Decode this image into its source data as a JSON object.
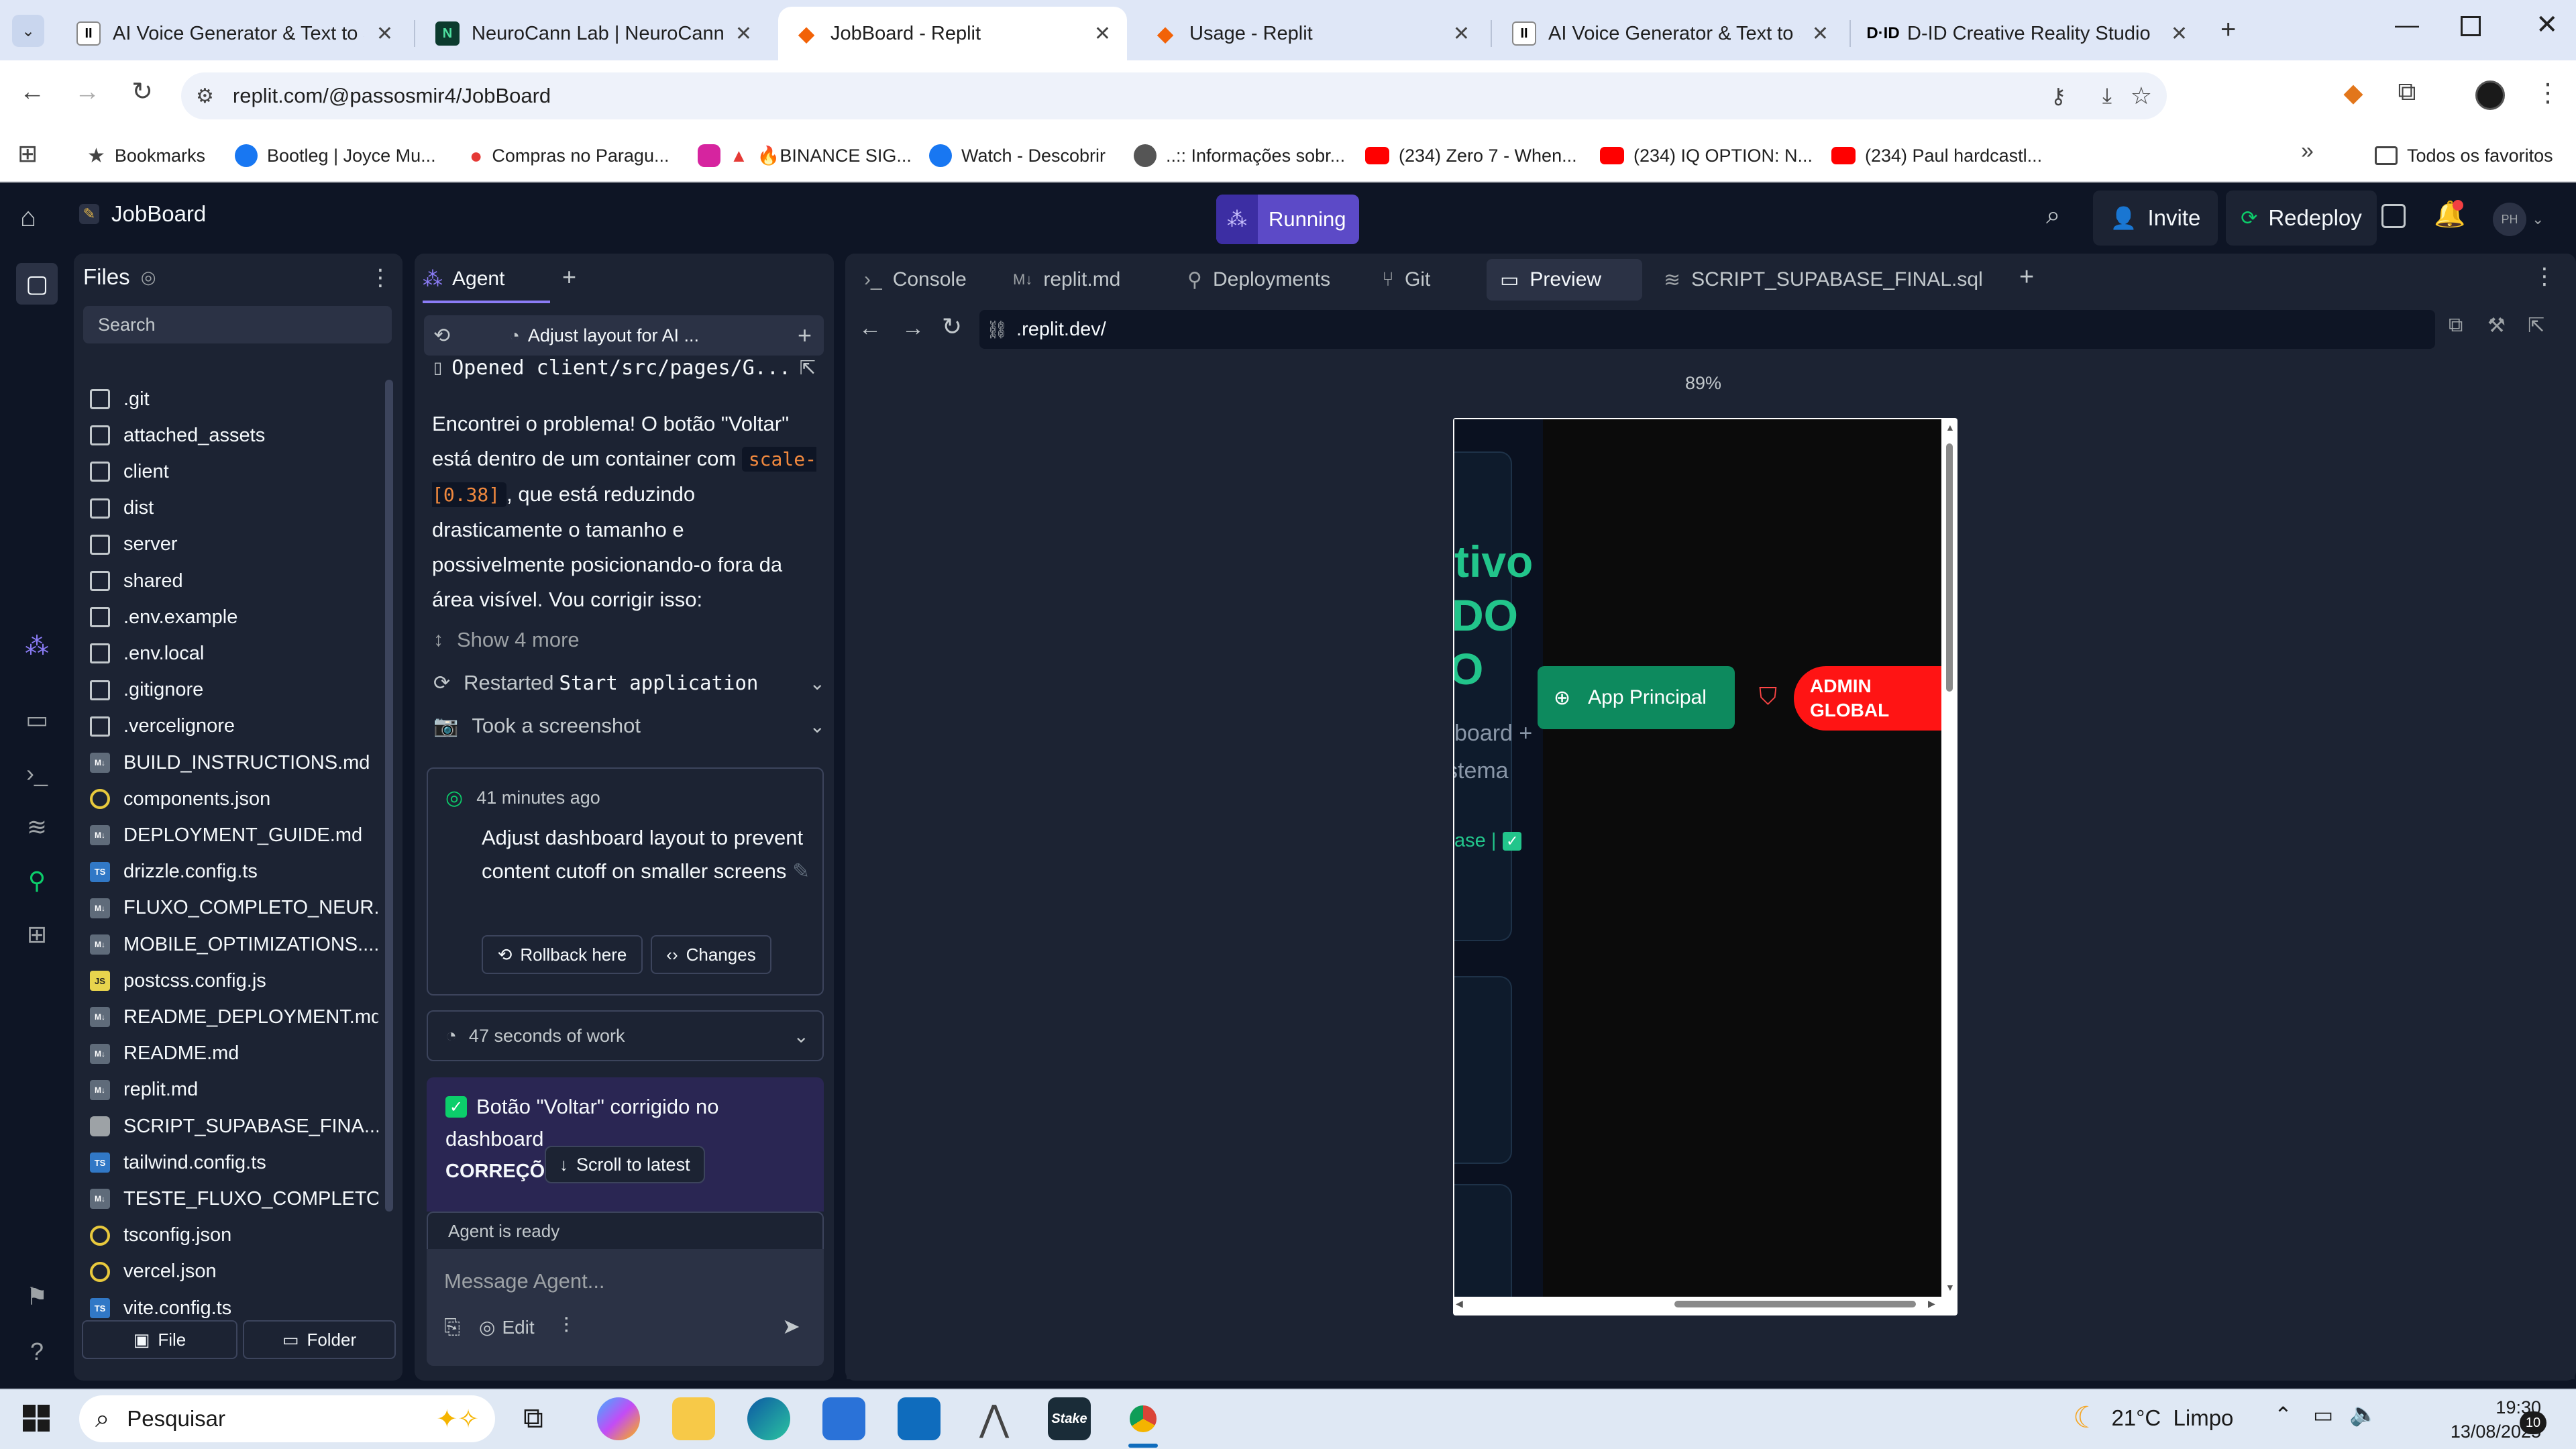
{
  "browser": {
    "tabs": [
      {
        "title": "AI Voice Generator & Text to Sp",
        "active": false,
        "favicon": "elevenlabs-icon"
      },
      {
        "title": "NeuroCann Lab | NeuroCann La",
        "active": false,
        "favicon": "neurocann-icon"
      },
      {
        "title": "JobBoard - Replit",
        "active": true,
        "favicon": "replit-icon"
      },
      {
        "title": "Usage - Replit",
        "active": false,
        "favicon": "replit-icon"
      },
      {
        "title": "AI Voice Generator & Text to Sp",
        "active": false,
        "favicon": "elevenlabs-icon"
      },
      {
        "title": "D-ID Creative Reality Studio",
        "active": false,
        "favicon": "d-id-icon"
      }
    ],
    "url": "replit.com/@passosmir4/JobBoard",
    "bookmarks": [
      {
        "label": "Bookmarks"
      },
      {
        "label": "Bootleg | Joyce Mu..."
      },
      {
        "label": "Compras no Paragu..."
      },
      {
        "label": "🔥BINANCE SIG..."
      },
      {
        "label": "Watch - Descobrir"
      },
      {
        "label": "..:: Informações sobr..."
      },
      {
        "label": "(234) Zero 7 - When..."
      },
      {
        "label": "(234) IQ OPTION: N..."
      },
      {
        "label": "(234) Paul hardcastl..."
      }
    ],
    "all_bookmarks": "Todos os favoritos"
  },
  "replit": {
    "project_name": "JobBoard",
    "run_status": "Running",
    "invite_label": "Invite",
    "redeploy_label": "Redeploy",
    "avatar_initials": "PH"
  },
  "files": {
    "title": "Files",
    "search_placeholder": "Search",
    "items": [
      {
        "name": ".git",
        "type": "folder"
      },
      {
        "name": "attached_assets",
        "type": "folder"
      },
      {
        "name": "client",
        "type": "folder"
      },
      {
        "name": "dist",
        "type": "folder"
      },
      {
        "name": "server",
        "type": "folder"
      },
      {
        "name": "shared",
        "type": "folder"
      },
      {
        "name": ".env.example",
        "type": "doc"
      },
      {
        "name": ".env.local",
        "type": "doc"
      },
      {
        "name": ".gitignore",
        "type": "doc"
      },
      {
        "name": ".vercelignore",
        "type": "doc"
      },
      {
        "name": "BUILD_INSTRUCTIONS.md",
        "type": "md"
      },
      {
        "name": "components.json",
        "type": "json"
      },
      {
        "name": "DEPLOYMENT_GUIDE.md",
        "type": "md"
      },
      {
        "name": "drizzle.config.ts",
        "type": "ts"
      },
      {
        "name": "FLUXO_COMPLETO_NEUR...",
        "type": "md"
      },
      {
        "name": "MOBILE_OPTIMIZATIONS....",
        "type": "md"
      },
      {
        "name": "postcss.config.js",
        "type": "js"
      },
      {
        "name": "README_DEPLOYMENT.md",
        "type": "md"
      },
      {
        "name": "README.md",
        "type": "md"
      },
      {
        "name": "replit.md",
        "type": "md"
      },
      {
        "name": "SCRIPT_SUPABASE_FINA...",
        "type": "sql"
      },
      {
        "name": "tailwind.config.ts",
        "type": "ts"
      },
      {
        "name": "TESTE_FLUXO_COMPLETO...",
        "type": "md"
      },
      {
        "name": "tsconfig.json",
        "type": "json"
      },
      {
        "name": "vercel.json",
        "type": "json"
      },
      {
        "name": "vite.config.ts",
        "type": "ts"
      }
    ],
    "new_file_label": "File",
    "new_folder_label": "Folder"
  },
  "agent": {
    "tab_label": "Agent",
    "thread_title": "Adjust layout for AI ...",
    "opened_file": "Opened client/src/pages/G...",
    "message_parts": [
      "Encontrei o problema! O botão \"Voltar\" está dentro de um container com ",
      "scale-[0.38]",
      ", que está reduzindo drasticamente o tamanho e possivelmente posicionando-o fora da área visível. Vou corrigir isso:"
    ],
    "show_more": "Show 4 more",
    "restarted_prefix": "Restarted ",
    "restarted_code": "Start application",
    "screenshot_label": "Took a screenshot",
    "checkpoint": {
      "time": "41 minutes ago",
      "title": "Adjust dashboard layout to prevent content cutoff on smaller screens",
      "rollback": "Rollback here",
      "changes": "Changes"
    },
    "work_summary": "47 seconds of work",
    "result_line1": "Botão \"Voltar\" corrigido no",
    "result_line2": "dashboard",
    "result_cut": "CORREÇÕES APLICADAS:",
    "scroll_latest": "Scroll to latest",
    "status": "Agent is ready",
    "input_placeholder": "Message Agent...",
    "edit_label": "Edit"
  },
  "workspace": {
    "tabs": [
      {
        "label": "Console",
        "icon": "terminal-icon"
      },
      {
        "label": "replit.md",
        "icon": "markdown-icon"
      },
      {
        "label": "Deployments",
        "icon": "deploy-icon"
      },
      {
        "label": "Git",
        "icon": "git-icon"
      },
      {
        "label": "Preview",
        "icon": "preview-icon",
        "active": true
      },
      {
        "label": "SCRIPT_SUPABASE_FINAL.sql",
        "icon": "database-icon"
      }
    ],
    "preview_url": ".replit.dev/",
    "zoom": "89%",
    "preview": {
      "heading_lines": [
        "tivo",
        "DO",
        "O"
      ],
      "sub_lines": [
        "board +",
        "stema"
      ],
      "footer_fragment": "ase |",
      "app_button": "App Principal",
      "admin_button": "ADMIN GLOBAL"
    }
  },
  "taskbar": {
    "search_placeholder": "Pesquisar",
    "weather": "21°C  Limpo",
    "time": "19:30",
    "date": "13/08/2025",
    "notifications": "10"
  }
}
